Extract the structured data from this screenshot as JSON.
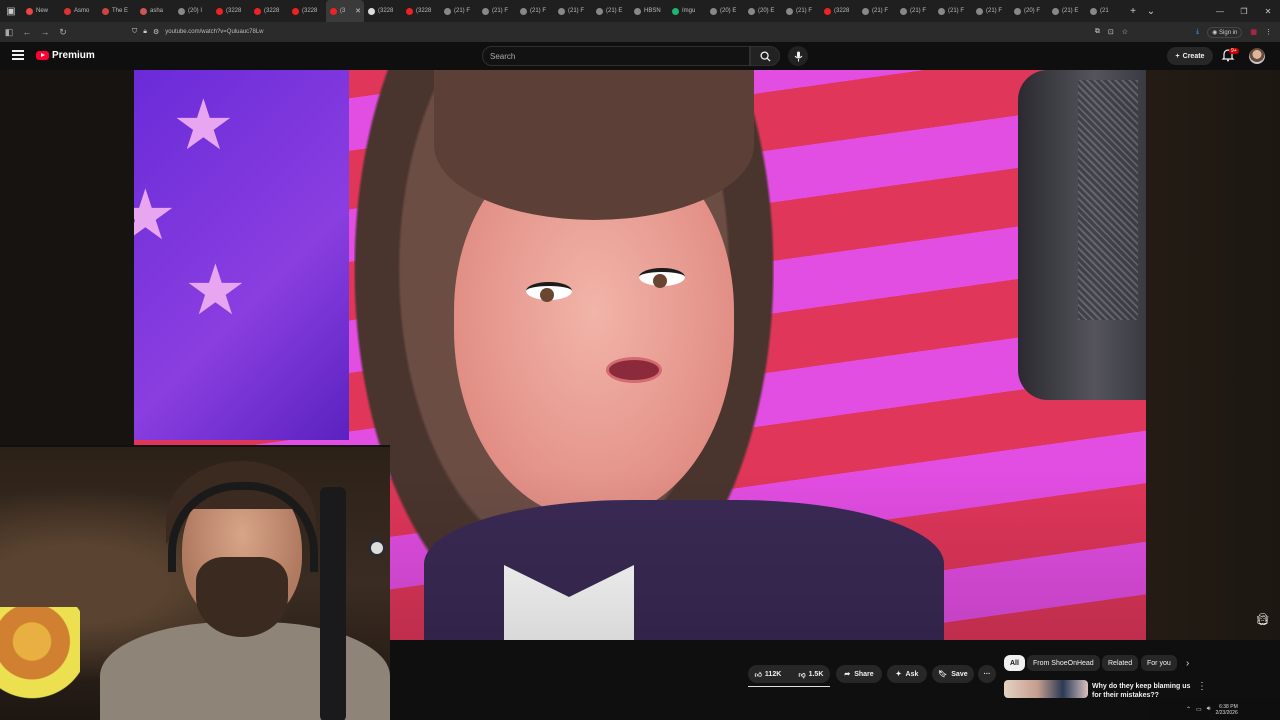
{
  "browser": {
    "tabs": [
      {
        "label": "New",
        "color": "#e44"
      },
      {
        "label": "Asmo",
        "color": "#d33"
      },
      {
        "label": "The E",
        "color": "#c44"
      },
      {
        "label": "asha",
        "color": "#c55"
      },
      {
        "label": "(20) I",
        "color": "#888"
      },
      {
        "label": "(3228",
        "color": "#e22"
      },
      {
        "label": "(3228",
        "color": "#e22"
      },
      {
        "label": "(3228",
        "color": "#e22"
      },
      {
        "label": "(3",
        "color": "#e22"
      },
      {
        "label": "(3228",
        "color": "#ddd"
      },
      {
        "label": "(3228",
        "color": "#e22"
      },
      {
        "label": "(21) F",
        "color": "#888"
      },
      {
        "label": "(21) F",
        "color": "#888"
      },
      {
        "label": "(21) F",
        "color": "#888"
      },
      {
        "label": "(21) F",
        "color": "#888"
      },
      {
        "label": "(21) E",
        "color": "#888"
      },
      {
        "label": "HBSN",
        "color": "#888"
      },
      {
        "label": "Imgu",
        "color": "#1bb76e"
      },
      {
        "label": "(20) E",
        "color": "#888"
      },
      {
        "label": "(20) E",
        "color": "#888"
      },
      {
        "label": "(21) F",
        "color": "#888"
      },
      {
        "label": "(3228",
        "color": "#e22"
      },
      {
        "label": "(21) F",
        "color": "#888"
      },
      {
        "label": "(21) F",
        "color": "#888"
      },
      {
        "label": "(21) F",
        "color": "#888"
      },
      {
        "label": "(21) F",
        "color": "#888"
      },
      {
        "label": "(20) F",
        "color": "#888"
      },
      {
        "label": "(21) E",
        "color": "#888"
      },
      {
        "label": "(21",
        "color": "#888"
      }
    ],
    "active_tab_index": 8,
    "url": "youtube.com/watch?v=Quluauc78Lw",
    "signin_label": "Sign in"
  },
  "header": {
    "logo_text": "Premium",
    "search_placeholder": "Search",
    "create_label": "Create",
    "notifications_badge": "9+"
  },
  "actions": {
    "like_count": "112K",
    "dislike_count": "1.5K",
    "share_label": "Share",
    "ask_label": "Ask",
    "save_label": "Save",
    "more_label": "···"
  },
  "chips": [
    "All",
    "From ShoeOnHead",
    "Related",
    "For you"
  ],
  "recommendation": {
    "title": "Why do they keep blaming us for their mistakes??"
  },
  "taskbar": {
    "time": "6:38 PM",
    "date": "2/23/2026"
  },
  "colors": {
    "accent": "#ff0033",
    "background": "#0f0f0f",
    "pill": "#272727"
  }
}
